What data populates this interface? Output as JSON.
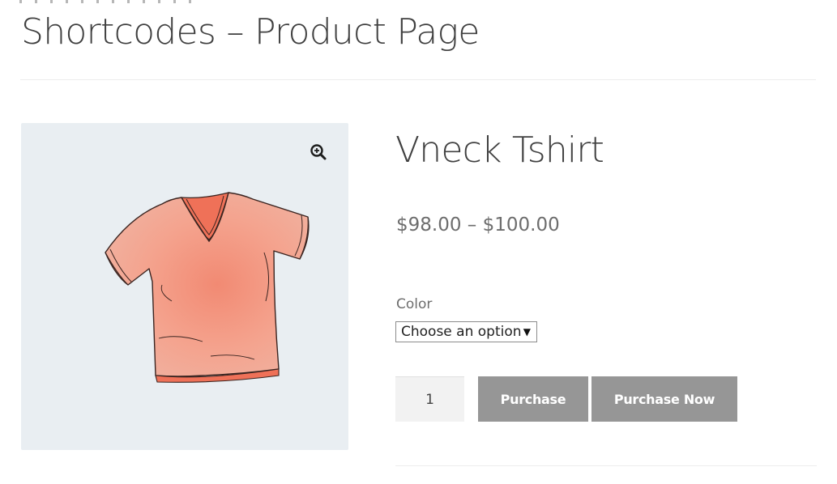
{
  "page": {
    "title": "Shortcodes – Product Page"
  },
  "product": {
    "name": "Vneck Tshirt",
    "price": "$98.00 – $100.00",
    "image_icon": "tshirt-image",
    "zoom_icon": "zoom-in-icon",
    "gallery_background": "#e9eef2",
    "shirt_color": "#f2a08c"
  },
  "variation": {
    "label": "Color",
    "selected": "Choose an option"
  },
  "cart": {
    "quantity": "1",
    "purchase_label": "Purchase",
    "purchase_now_label": "Purchase Now",
    "button_color": "#969696"
  }
}
